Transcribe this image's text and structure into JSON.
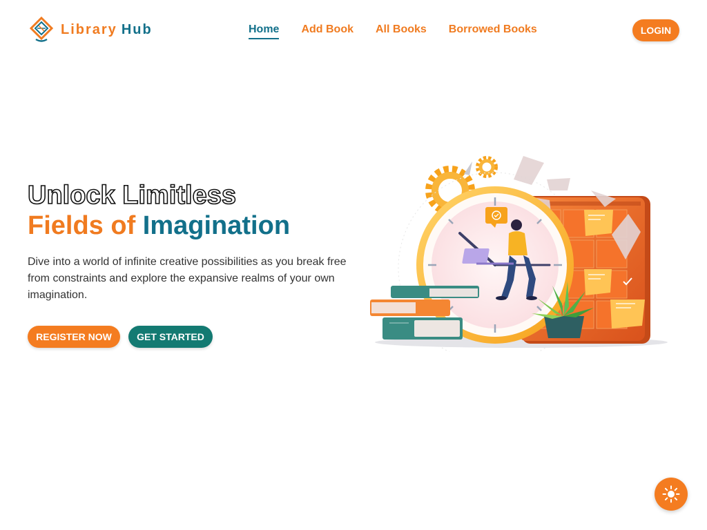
{
  "brand": {
    "word1": "Library",
    "word2": "Hub",
    "logo_icon": "book-diamond-icon"
  },
  "nav": {
    "links": [
      {
        "label": "Home",
        "active": true
      },
      {
        "label": "Add Book",
        "active": false
      },
      {
        "label": "All Books",
        "active": false
      },
      {
        "label": "Borrowed Books",
        "active": false
      }
    ],
    "login_label": "LOGIN"
  },
  "hero": {
    "title_line1": "Unlock Limitless",
    "title_line2_a": "Fields of",
    "title_line2_b": "Imagination",
    "description": "Dive into a world of infinite creative possibilities as you break free from constraints and explore the expansive realms of your own imagination.",
    "register_label": "REGISTER NOW",
    "start_label": "GET STARTED",
    "illustration_icon": "reading-clock-illustration"
  },
  "theme_toggle": {
    "icon": "sun-icon"
  },
  "colors": {
    "orange": "#f47c20",
    "teal": "#12708a",
    "green_button": "#137a72"
  }
}
